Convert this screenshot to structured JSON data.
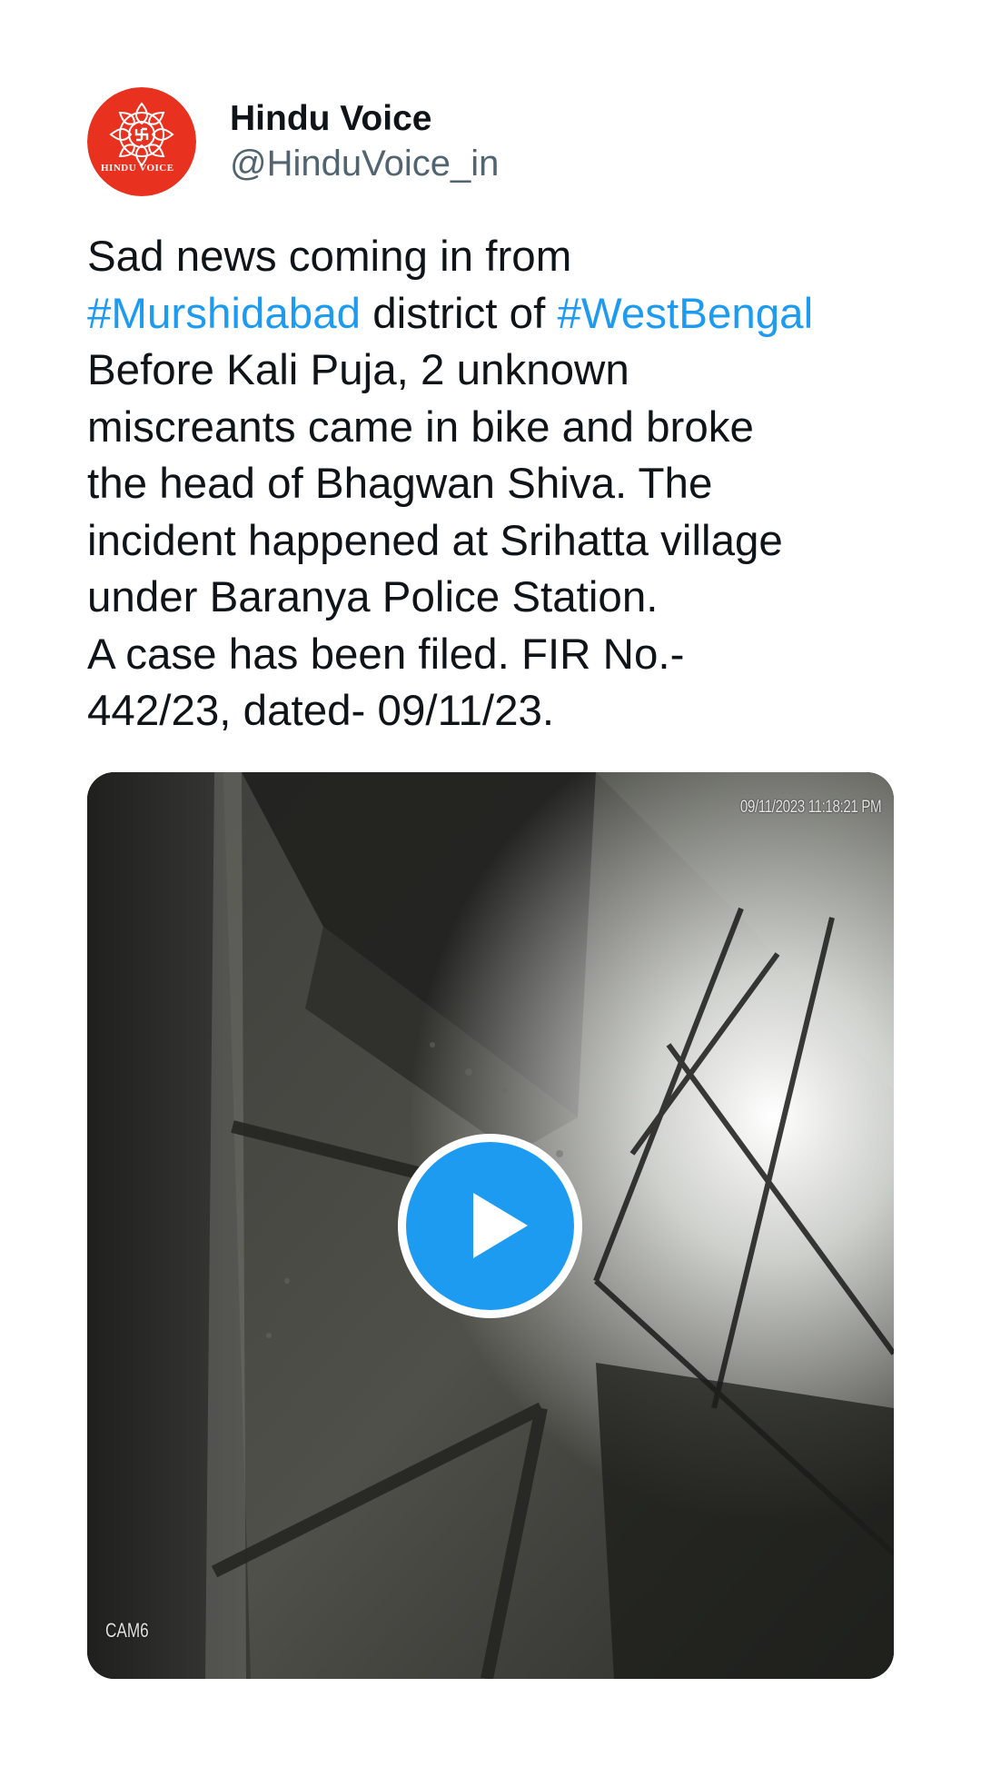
{
  "author": {
    "display_name": "Hindu Voice",
    "handle": "@HinduVoice_in",
    "avatar_text": "HINDU VOICE",
    "avatar_icon": "swastika-lotus-emblem",
    "avatar_color": "#e8321f"
  },
  "tweet": {
    "segments": [
      {
        "text": "Sad news coming in from\n",
        "type": "text"
      },
      {
        "text": "#Murshidabad",
        "type": "hashtag"
      },
      {
        "text": " district of ",
        "type": "text"
      },
      {
        "text": "#WestBengal",
        "type": "hashtag"
      },
      {
        "text": "\nBefore Kali Puja, 2 unknown\nmiscreants came in bike and broke\nthe head of Bhagwan Shiva. The\nincident happened at Srihatta village\nunder Baranya Police Station.\nA case has been filed. FIR No.-\n442/23, dated- 09/11/23.",
        "type": "text"
      }
    ],
    "hashtag_color": "#1d9bf0"
  },
  "media": {
    "type": "video",
    "timestamp_overlay": "09/11/2023 11:18:21 PM",
    "camera_label": "CAM6",
    "play_icon": "play-icon",
    "play_color": "#1d9bf0"
  }
}
